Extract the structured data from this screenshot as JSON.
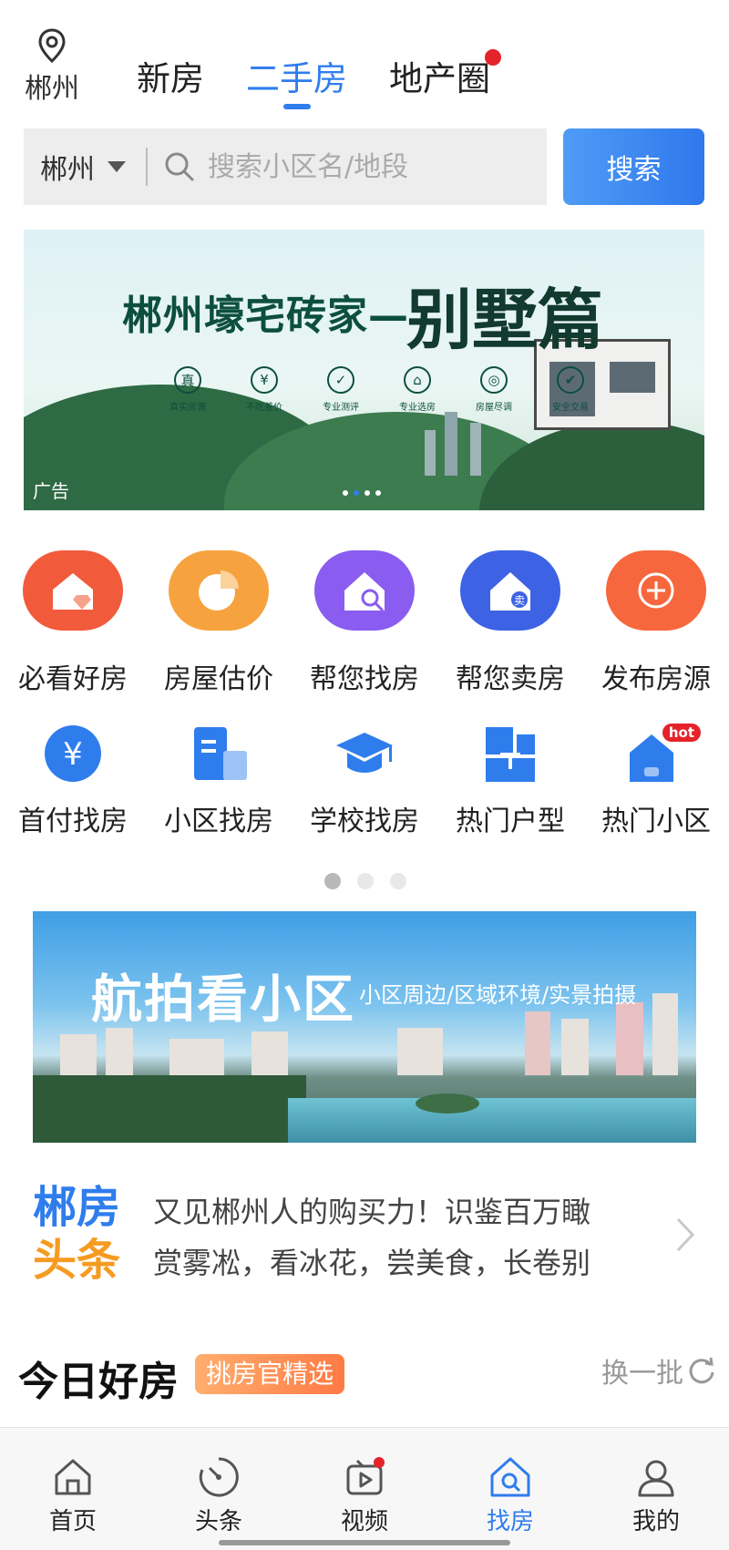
{
  "location": {
    "city": "郴州"
  },
  "top_tabs": [
    {
      "label": "新房"
    },
    {
      "label": "二手房",
      "active": true
    },
    {
      "label": "地产圈",
      "has_dot": true
    }
  ],
  "search": {
    "city": "郴州",
    "placeholder": "搜索小区名/地段",
    "button_label": "搜索"
  },
  "banner1": {
    "title": "郴州壕宅砖家—",
    "title2": "别墅篇",
    "features": [
      {
        "glyph": "真",
        "label": "真实房源"
      },
      {
        "glyph": "¥",
        "label": "不吃差价"
      },
      {
        "glyph": "✓",
        "label": "专业测评"
      },
      {
        "glyph": "⌂",
        "label": "专业选房"
      },
      {
        "glyph": "◎",
        "label": "房屋尽调"
      },
      {
        "glyph": "✔",
        "label": "安全交易"
      }
    ],
    "ad_label": "广告"
  },
  "grid_row1": [
    {
      "label": "必看好房",
      "color": "#f25a3c",
      "icon": "house-gem-icon"
    },
    {
      "label": "房屋估价",
      "color": "#f6a23e",
      "icon": "pie-chart-icon"
    },
    {
      "label": "帮您找房",
      "color": "#8a5cf0",
      "icon": "house-search-icon"
    },
    {
      "label": "帮您卖房",
      "color": "#3d63e4",
      "icon": "house-sell-icon"
    },
    {
      "label": "发布房源",
      "color": "#f7673d",
      "icon": "plus-icon"
    }
  ],
  "grid_row2": [
    {
      "label": "首付找房",
      "icon": "yuan-icon"
    },
    {
      "label": "小区找房",
      "icon": "building-icon"
    },
    {
      "label": "学校找房",
      "icon": "graduation-cap-icon"
    },
    {
      "label": "热门户型",
      "icon": "floorplan-icon"
    },
    {
      "label": "热门小区",
      "icon": "hot-community-icon",
      "badge": "hot"
    }
  ],
  "banner2": {
    "title": "航拍看小区",
    "subtitle": "小区周边/区域环境/实景拍摄"
  },
  "news": {
    "logo_line1": "郴房",
    "logo_line2": "头条",
    "items": [
      "又见郴州人的购买力！识鉴百万瞰",
      "赏雾凇，看冰花，尝美食，长卷别"
    ]
  },
  "today": {
    "title": "今日好房",
    "tag": "挑房官精选",
    "refresh_label": "换一批"
  },
  "bottom_nav": [
    {
      "label": "首页",
      "icon": "home-icon"
    },
    {
      "label": "头条",
      "icon": "headline-icon"
    },
    {
      "label": "视频",
      "icon": "video-icon"
    },
    {
      "label": "找房",
      "icon": "find-house-icon",
      "active": true
    },
    {
      "label": "我的",
      "icon": "user-icon"
    }
  ],
  "colors": {
    "accent": "#2f7ded",
    "badge_red": "#e4232b"
  }
}
